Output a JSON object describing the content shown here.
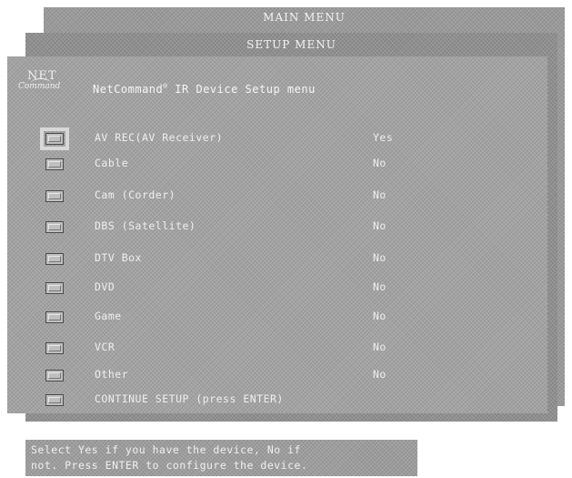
{
  "main_menu": {
    "title": "MAIN MENU"
  },
  "setup_menu": {
    "title": "SETUP MENU"
  },
  "ir_setup": {
    "logo": {
      "top": "NET",
      "bottom": "Command"
    },
    "title": "NetCommand",
    "title_mark": "®",
    "title_suffix": " IR Device Setup menu",
    "devices": [
      {
        "label": "AV REC(AV Receiver)",
        "value": "Yes",
        "focused": true
      },
      {
        "label": "Cable",
        "value": "No"
      },
      {
        "label": "Cam (Corder)",
        "value": "No"
      },
      {
        "label": "DBS (Satellite)",
        "value": "No"
      },
      {
        "label": "DTV Box",
        "value": "No"
      },
      {
        "label": "DVD",
        "value": "No"
      },
      {
        "label": "Game",
        "value": "No"
      },
      {
        "label": "VCR",
        "value": "No"
      },
      {
        "label": "Other",
        "value": "No"
      }
    ],
    "continue_label": "CONTINUE SETUP (press ENTER)"
  },
  "help": {
    "line1": "Select Yes if you have the device, No if",
    "line2": "not. Press ENTER to configure the device."
  }
}
